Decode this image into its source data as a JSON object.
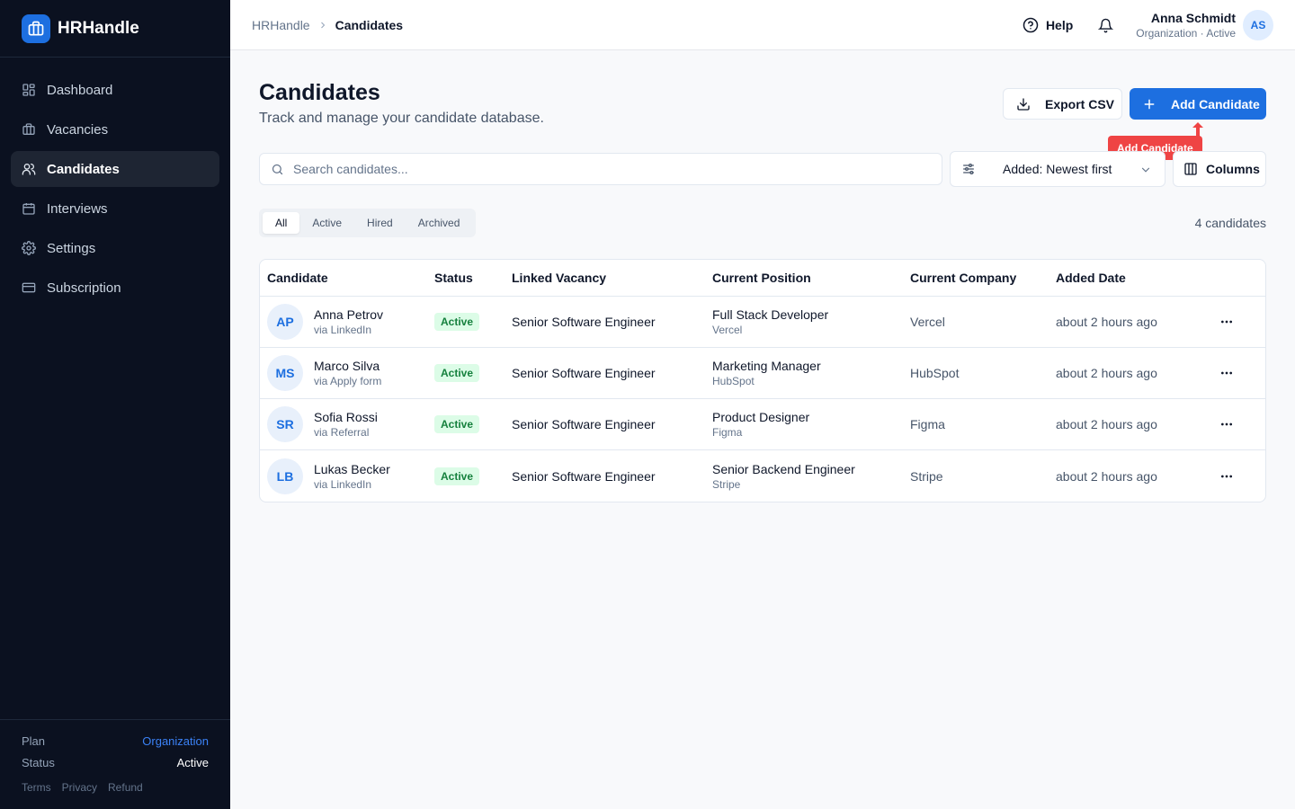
{
  "app": {
    "name": "HRHandle",
    "accent": "#1d6fe0"
  },
  "sidebar": {
    "items": [
      {
        "label": "Dashboard",
        "icon": "dashboard-icon"
      },
      {
        "label": "Vacancies",
        "icon": "briefcase-icon"
      },
      {
        "label": "Candidates",
        "icon": "users-icon",
        "active": true
      },
      {
        "label": "Interviews",
        "icon": "calendar-icon"
      },
      {
        "label": "Settings",
        "icon": "gear-icon"
      },
      {
        "label": "Subscription",
        "icon": "credit-card-icon"
      }
    ],
    "footer": {
      "plan_label": "Plan",
      "plan_value": "Organization",
      "status_label": "Status",
      "status_value": "Active",
      "links": [
        "Terms",
        "Privacy",
        "Refund"
      ]
    }
  },
  "header": {
    "breadcrumb_root": "HRHandle",
    "breadcrumb_current": "Candidates",
    "help_label": "Help",
    "user_name": "Anna Schmidt",
    "user_sub": "Organization · Active",
    "user_initials": "AS"
  },
  "page": {
    "title": "Candidates",
    "subtitle": "Track and manage your candidate database.",
    "export_label": "Export CSV",
    "add_label": "Add Candidate",
    "tooltip": "Add Candidate",
    "search_placeholder": "Search candidates...",
    "sort_label": "Added: Newest first",
    "columns_label": "Columns",
    "tabs": [
      "All",
      "Active",
      "Hired",
      "Archived"
    ],
    "active_tab": "All",
    "count": "4 candidates"
  },
  "table": {
    "headers": [
      "Candidate",
      "Status",
      "Linked Vacancy",
      "Current Position",
      "Current Company",
      "Added Date"
    ],
    "rows": [
      {
        "initials": "AP",
        "name": "Anna Petrov",
        "source": "via LinkedIn",
        "status": "Active",
        "vacancy": "Senior Software Engineer",
        "position": "Full Stack Developer",
        "position_company": "Vercel",
        "company": "Vercel",
        "added": "about 2 hours ago"
      },
      {
        "initials": "MS",
        "name": "Marco Silva",
        "source": "via Apply form",
        "status": "Active",
        "vacancy": "Senior Software Engineer",
        "position": "Marketing Manager",
        "position_company": "HubSpot",
        "company": "HubSpot",
        "added": "about 2 hours ago"
      },
      {
        "initials": "SR",
        "name": "Sofia Rossi",
        "source": "via Referral",
        "status": "Active",
        "vacancy": "Senior Software Engineer",
        "position": "Product Designer",
        "position_company": "Figma",
        "company": "Figma",
        "added": "about 2 hours ago"
      },
      {
        "initials": "LB",
        "name": "Lukas Becker",
        "source": "via LinkedIn",
        "status": "Active",
        "vacancy": "Senior Software Engineer",
        "position": "Senior Backend Engineer",
        "position_company": "Stripe",
        "company": "Stripe",
        "added": "about 2 hours ago"
      }
    ]
  }
}
